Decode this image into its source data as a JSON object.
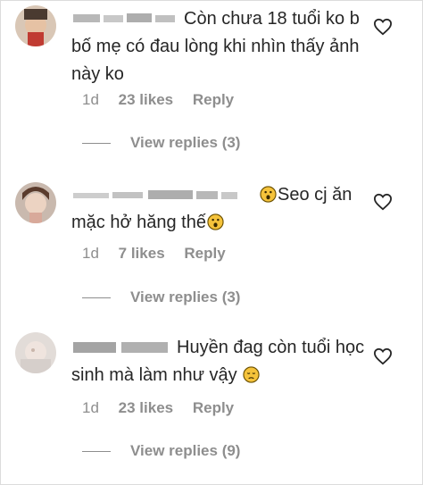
{
  "comments": [
    {
      "text": "Còn chưa 18 tuổi ko b bố mẹ có đau lòng khi nhìn thấy ảnh này ko",
      "time": "1d",
      "likes": "23 likes",
      "reply": "Reply",
      "view_replies": "View replies (3)",
      "emoji": []
    },
    {
      "text_before": "Seo cj ăn mặc hở hăng thế",
      "time": "1d",
      "likes": "7 likes",
      "reply": "Reply",
      "view_replies": "View replies (3)",
      "emoji": [
        "surprised-emoji",
        "surprised-emoji"
      ]
    },
    {
      "text": "Huyền đag còn tuổi học sinh mà làm như vậy",
      "time": "1d",
      "likes": "23 likes",
      "reply": "Reply",
      "view_replies": "View replies (9)",
      "emoji": [
        "disappointed-emoji"
      ]
    }
  ],
  "colors": {
    "text": "#262626",
    "muted": "#8e8e8e",
    "emoji": "#f5c33b"
  }
}
